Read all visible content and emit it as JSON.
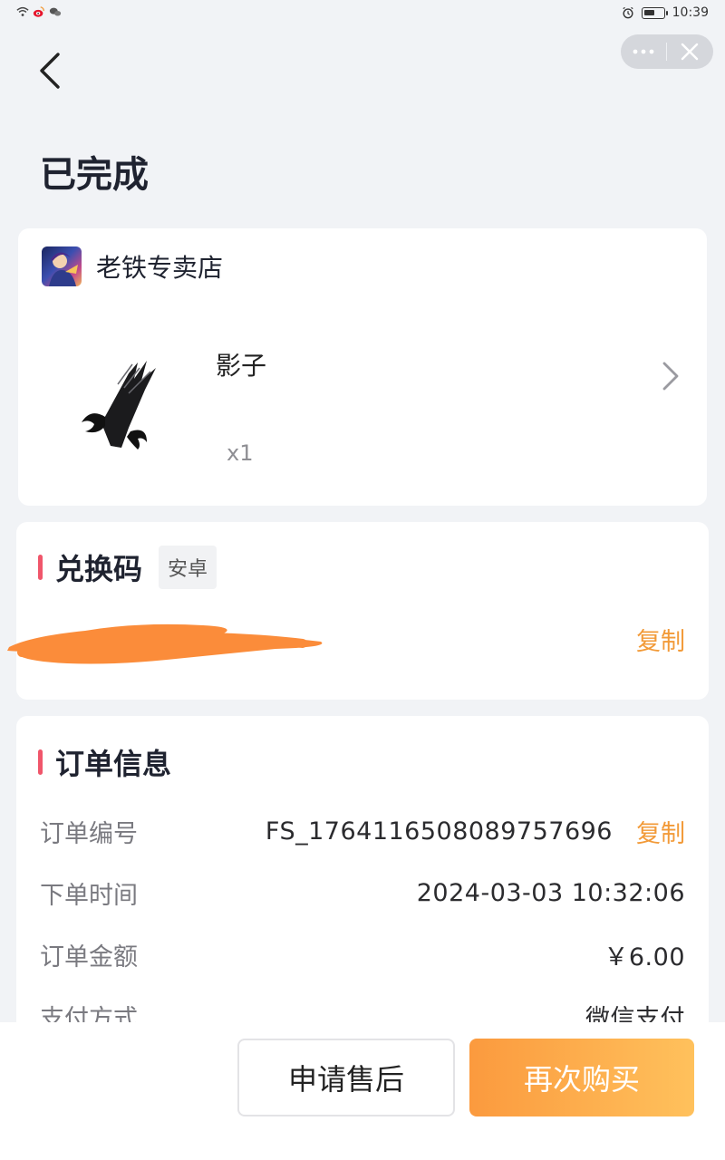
{
  "status_bar": {
    "time": "10:39",
    "battery_level": 0.6
  },
  "header": {
    "title": "已完成"
  },
  "shop": {
    "name": "老铁专卖店"
  },
  "product": {
    "name": "影子",
    "quantity": "x1"
  },
  "redeem_code": {
    "title": "兑换码",
    "platform": "安卓",
    "copy_label": "复制"
  },
  "order_info": {
    "title": "订单信息",
    "rows": [
      {
        "label": "订单编号",
        "value": "FS_1764116508089757696",
        "action": "复制"
      },
      {
        "label": "下单时间",
        "value": "2024-03-03 10:32:06"
      },
      {
        "label": "订单金额",
        "value": "￥6.00"
      },
      {
        "label": "支付方式",
        "value": "微信支付"
      }
    ]
  },
  "actions": {
    "after_sale_label": "申请售后",
    "rebuy_label": "再次购买"
  },
  "colors": {
    "accent": "#f0566b",
    "copy": "#f29a38",
    "primary_button_start": "#fb9a3e",
    "primary_button_end": "#ffc15c"
  }
}
